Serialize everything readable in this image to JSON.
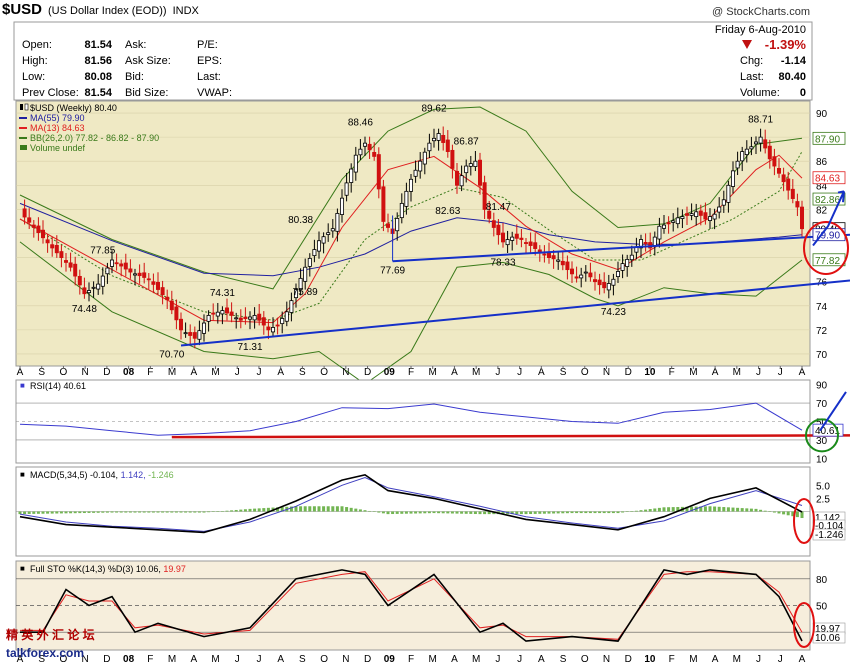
{
  "header": {
    "symbol": "$USD",
    "name": "(US Dollar Index (EOD))",
    "exchange": "INDX",
    "credit": "@ StockCharts.com",
    "date": "Friday   6-Aug-2010"
  },
  "quote": {
    "left": [
      [
        "Open:",
        "81.54"
      ],
      [
        "High:",
        "81.56"
      ],
      [
        "Low:",
        "80.08"
      ],
      [
        "Prev Close:",
        "81.54"
      ]
    ],
    "mid_labels": [
      "Ask:",
      "Ask Size:",
      "Bid:",
      "Bid Size:"
    ],
    "fund_labels": [
      "P/E:",
      "EPS:",
      "Last:",
      "VWAP:"
    ],
    "pct_change": "-1.39%",
    "right": [
      [
        "Chg:",
        "-1.14"
      ],
      [
        "Last:",
        "80.40"
      ],
      [
        "Volume:",
        "0"
      ]
    ]
  },
  "legend": {
    "price": "$USD (Weekly) 80.40",
    "ma55": "MA(55) 79.90",
    "ma13": "MA(13) 84.63",
    "bb": "BB(26,2.0) 77.82 - 86.82 - 87.90",
    "vol": "Volume undef"
  },
  "colors": {
    "up": "#1f8f1f",
    "down": "#d01010",
    "ma55": "#2020a0",
    "ma13": "#e02020",
    "bb": "#3a7a1a",
    "trend": "#1530c8",
    "panel_bg": "#efe9c4",
    "sto_bg": "#f6eedc"
  },
  "chart_data": [
    {
      "type": "candlestick",
      "title": "$USD (Weekly)",
      "ylim": [
        69,
        91
      ],
      "y_ticks": [
        70,
        72,
        74,
        76,
        78,
        80,
        82,
        84,
        86,
        88,
        90
      ],
      "x_ticks": [
        "A",
        "S",
        "O",
        "N",
        "D",
        "08",
        "F",
        "M",
        "A",
        "M",
        "J",
        "J",
        "A",
        "S",
        "O",
        "N",
        "D",
        "09",
        "F",
        "M",
        "A",
        "M",
        "J",
        "J",
        "A",
        "S",
        "O",
        "N",
        "D",
        "10",
        "F",
        "M",
        "A",
        "M",
        "J",
        "J",
        "A"
      ],
      "close_series": [
        [
          0,
          81.8
        ],
        [
          3,
          80.5
        ],
        [
          7,
          78.8
        ],
        [
          11,
          77.2
        ],
        [
          14,
          75.0
        ],
        [
          17,
          75.8
        ],
        [
          20,
          77.8
        ],
        [
          24,
          76.8
        ],
        [
          28,
          76.2
        ],
        [
          32,
          74.5
        ],
        [
          35,
          72.0
        ],
        [
          38,
          71.3
        ],
        [
          41,
          73.2
        ],
        [
          44,
          73.6
        ],
        [
          48,
          72.8
        ],
        [
          51,
          73.2
        ],
        [
          54,
          72.0
        ],
        [
          56,
          72.4
        ],
        [
          58,
          73.5
        ],
        [
          62,
          77.2
        ],
        [
          65,
          79.4
        ],
        [
          68,
          80.4
        ],
        [
          71,
          84.2
        ],
        [
          73,
          86.5
        ],
        [
          75,
          87.5
        ],
        [
          77,
          86.4
        ],
        [
          79,
          81.0
        ],
        [
          81,
          80.0
        ],
        [
          83,
          82.5
        ],
        [
          85,
          84.5
        ],
        [
          87,
          86.0
        ],
        [
          89,
          87.5
        ],
        [
          91,
          88.3
        ],
        [
          93,
          86.8
        ],
        [
          95,
          84.0
        ],
        [
          97,
          85.6
        ],
        [
          99,
          86.0
        ],
        [
          101,
          82.0
        ],
        [
          103,
          80.5
        ],
        [
          105,
          79.3
        ],
        [
          107,
          79.7
        ],
        [
          109,
          79.5
        ],
        [
          111,
          79.0
        ],
        [
          113,
          78.5
        ],
        [
          115,
          78.0
        ],
        [
          117,
          77.8
        ],
        [
          119,
          77.0
        ],
        [
          121,
          76.3
        ],
        [
          123,
          76.8
        ],
        [
          125,
          76.0
        ],
        [
          127,
          75.5
        ],
        [
          129,
          76.2
        ],
        [
          131,
          77.5
        ],
        [
          133,
          78.2
        ],
        [
          135,
          79.5
        ],
        [
          137,
          78.8
        ],
        [
          139,
          80.6
        ],
        [
          141,
          80.8
        ],
        [
          143,
          81.3
        ],
        [
          145,
          81.5
        ],
        [
          147,
          81.8
        ],
        [
          149,
          81.2
        ],
        [
          151,
          81.6
        ],
        [
          153,
          82.8
        ],
        [
          155,
          85.2
        ],
        [
          157,
          86.8
        ],
        [
          159,
          87.2
        ],
        [
          161,
          88.0
        ],
        [
          163,
          86.2
        ],
        [
          165,
          85.0
        ],
        [
          167,
          83.6
        ],
        [
          169,
          82.2
        ],
        [
          170,
          80.4
        ]
      ],
      "bb_upper": [
        [
          0,
          83.2
        ],
        [
          20,
          79.5
        ],
        [
          40,
          76.8
        ],
        [
          55,
          75.4
        ],
        [
          70,
          84.5
        ],
        [
          80,
          88.5
        ],
        [
          90,
          90.3
        ],
        [
          100,
          90.5
        ],
        [
          110,
          88.5
        ],
        [
          120,
          83.5
        ],
        [
          130,
          80.5
        ],
        [
          140,
          80.8
        ],
        [
          150,
          82.5
        ],
        [
          160,
          87.4
        ],
        [
          170,
          87.9
        ]
      ],
      "bb_lower": [
        [
          0,
          79.3
        ],
        [
          20,
          73.5
        ],
        [
          40,
          70.2
        ],
        [
          55,
          69.6
        ],
        [
          65,
          70.2
        ],
        [
          75,
          67.5
        ],
        [
          85,
          70.2
        ],
        [
          95,
          77.2
        ],
        [
          105,
          77.6
        ],
        [
          115,
          76.6
        ],
        [
          125,
          74.6
        ],
        [
          130,
          74.0
        ],
        [
          140,
          75.5
        ],
        [
          150,
          75.0
        ],
        [
          160,
          74.8
        ],
        [
          170,
          77.8
        ]
      ],
      "ma13": [
        [
          0,
          81.2
        ],
        [
          20,
          77.0
        ],
        [
          40,
          72.8
        ],
        [
          55,
          72.6
        ],
        [
          62,
          75.0
        ],
        [
          70,
          80.5
        ],
        [
          80,
          85.3
        ],
        [
          90,
          86.4
        ],
        [
          100,
          83.8
        ],
        [
          110,
          80.6
        ],
        [
          120,
          78.3
        ],
        [
          130,
          77.0
        ],
        [
          140,
          79.3
        ],
        [
          150,
          81.3
        ],
        [
          160,
          85.3
        ],
        [
          165,
          86.5
        ],
        [
          170,
          84.6
        ]
      ],
      "ma55": [
        [
          0,
          82.5
        ],
        [
          20,
          79.4
        ],
        [
          40,
          76.7
        ],
        [
          55,
          76.5
        ],
        [
          65,
          77.2
        ],
        [
          75,
          78.3
        ],
        [
          85,
          80.2
        ],
        [
          95,
          81.3
        ],
        [
          105,
          80.9
        ],
        [
          115,
          79.9
        ],
        [
          125,
          79.3
        ],
        [
          135,
          79.1
        ],
        [
          145,
          79.1
        ],
        [
          155,
          79.4
        ],
        [
          165,
          79.7
        ],
        [
          170,
          79.9
        ]
      ],
      "bb_mid": [
        [
          0,
          81.2
        ],
        [
          20,
          76.5
        ],
        [
          40,
          73.5
        ],
        [
          55,
          72.8
        ],
        [
          65,
          74.2
        ],
        [
          75,
          79.5
        ],
        [
          85,
          82.2
        ],
        [
          95,
          83.8
        ],
        [
          105,
          83.0
        ],
        [
          115,
          80.3
        ],
        [
          125,
          77.8
        ],
        [
          135,
          77.8
        ],
        [
          145,
          79.5
        ],
        [
          155,
          81.2
        ],
        [
          165,
          83.5
        ],
        [
          170,
          86.8
        ]
      ],
      "peak_labels": [
        [
          "77.85",
          18
        ],
        [
          "74.48",
          14
        ],
        [
          "70.70",
          33
        ],
        [
          "74.31",
          44
        ],
        [
          "71.31",
          50
        ],
        [
          "75.89",
          62
        ],
        [
          "80.38",
          61
        ],
        [
          "88.46",
          74
        ],
        [
          "77.69",
          81
        ],
        [
          "89.62",
          90
        ],
        [
          "86.87",
          97
        ],
        [
          "82.63",
          93
        ],
        [
          "81.47",
          104
        ],
        [
          "78.33",
          105
        ],
        [
          "74.23",
          129
        ],
        [
          "88.71",
          161
        ]
      ],
      "right_labels": [
        "87.90",
        "84.63",
        "82.86",
        "80.40",
        "79.90",
        "77.82"
      ]
    },
    {
      "type": "line",
      "title": "RSI(14) 40.61",
      "ylim": [
        5,
        95
      ],
      "y_ticks": [
        90,
        70,
        50,
        30,
        10
      ],
      "values": [
        [
          0,
          47
        ],
        [
          10,
          45
        ],
        [
          20,
          40
        ],
        [
          30,
          35
        ],
        [
          40,
          37
        ],
        [
          50,
          40
        ],
        [
          60,
          50
        ],
        [
          70,
          65
        ],
        [
          80,
          64
        ],
        [
          90,
          69
        ],
        [
          100,
          60
        ],
        [
          110,
          55
        ],
        [
          120,
          50
        ],
        [
          130,
          48
        ],
        [
          140,
          60
        ],
        [
          150,
          63
        ],
        [
          160,
          70
        ],
        [
          170,
          40.61
        ]
      ],
      "right_label": "40.61"
    },
    {
      "type": "line",
      "title": "MACD(5,34,5)",
      "series": [
        {
          "name": "-0.104",
          "values": [
            [
              0,
              -1.0
            ],
            [
              10,
              -2.5
            ],
            [
              20,
              -3.0
            ],
            [
              30,
              -3.5
            ],
            [
              40,
              -4.0
            ],
            [
              50,
              -1.5
            ],
            [
              60,
              2.0
            ],
            [
              70,
              6.0
            ],
            [
              75,
              7.0
            ],
            [
              80,
              4.0
            ],
            [
              90,
              2.5
            ],
            [
              100,
              0.5
            ],
            [
              110,
              -1.5
            ],
            [
              120,
              -2.5
            ],
            [
              130,
              -3.5
            ],
            [
              140,
              -1.0
            ],
            [
              150,
              2.5
            ],
            [
              160,
              4.5
            ],
            [
              170,
              -0.104
            ]
          ]
        },
        {
          "name": "1.142",
          "values": [
            [
              0,
              -0.5
            ],
            [
              10,
              -2.0
            ],
            [
              20,
              -2.8
            ],
            [
              30,
              -3.2
            ],
            [
              40,
              -3.8
            ],
            [
              50,
              -2.0
            ],
            [
              60,
              1.0
            ],
            [
              70,
              5.0
            ],
            [
              75,
              6.5
            ],
            [
              80,
              4.5
            ],
            [
              90,
              2.8
            ],
            [
              100,
              1.0
            ],
            [
              110,
              -1.0
            ],
            [
              120,
              -2.2
            ],
            [
              130,
              -3.2
            ],
            [
              140,
              -1.8
            ],
            [
              150,
              1.5
            ],
            [
              160,
              4.0
            ],
            [
              170,
              1.142
            ]
          ]
        },
        {
          "name": "-1.246",
          "values": [
            [
              0,
              -0.5
            ],
            [
              20,
              -0.2
            ],
            [
              40,
              -0.2
            ],
            [
              50,
              0.5
            ],
            [
              60,
              1.0
            ],
            [
              70,
              1.0
            ],
            [
              80,
              -0.5
            ],
            [
              90,
              -0.3
            ],
            [
              100,
              -0.5
            ],
            [
              110,
              -0.5
            ],
            [
              120,
              -0.3
            ],
            [
              130,
              -0.3
            ],
            [
              140,
              0.8
            ],
            [
              150,
              1.0
            ],
            [
              160,
              0.5
            ],
            [
              170,
              -1.246
            ]
          ]
        }
      ],
      "y_ticks": [
        5.0,
        2.5,
        -2.5
      ],
      "right_labels": [
        "1.142",
        "-0.104",
        "-1.246"
      ]
    },
    {
      "type": "line",
      "title": "Full STO %K(14,3) %D(3)",
      "ylim": [
        0,
        100
      ],
      "y_ticks": [
        80,
        50,
        20
      ],
      "series": [
        {
          "name": "10.06",
          "values": [
            [
              0,
              20
            ],
            [
              5,
              20
            ],
            [
              10,
              68
            ],
            [
              15,
              50
            ],
            [
              20,
              60
            ],
            [
              25,
              20
            ],
            [
              30,
              30
            ],
            [
              40,
              15
            ],
            [
              50,
              25
            ],
            [
              60,
              80
            ],
            [
              70,
              90
            ],
            [
              75,
              85
            ],
            [
              80,
              50
            ],
            [
              90,
              85
            ],
            [
              100,
              20
            ],
            [
              105,
              30
            ],
            [
              110,
              10
            ],
            [
              120,
              15
            ],
            [
              130,
              10
            ],
            [
              140,
              90
            ],
            [
              145,
              85
            ],
            [
              150,
              90
            ],
            [
              160,
              85
            ],
            [
              165,
              60
            ],
            [
              170,
              10.06
            ]
          ]
        },
        {
          "name": "19.97",
          "values": [
            [
              0,
              22
            ],
            [
              5,
              22
            ],
            [
              10,
              62
            ],
            [
              15,
              55
            ],
            [
              20,
              55
            ],
            [
              25,
              25
            ],
            [
              30,
              28
            ],
            [
              40,
              18
            ],
            [
              50,
              22
            ],
            [
              60,
              75
            ],
            [
              70,
              85
            ],
            [
              75,
              88
            ],
            [
              80,
              55
            ],
            [
              90,
              80
            ],
            [
              100,
              25
            ],
            [
              105,
              28
            ],
            [
              110,
              15
            ],
            [
              120,
              15
            ],
            [
              130,
              12
            ],
            [
              140,
              85
            ],
            [
              145,
              88
            ],
            [
              150,
              88
            ],
            [
              160,
              85
            ],
            [
              165,
              65
            ],
            [
              170,
              19.97
            ]
          ]
        }
      ],
      "right_labels": [
        "19.97",
        "10.06"
      ]
    }
  ]
}
